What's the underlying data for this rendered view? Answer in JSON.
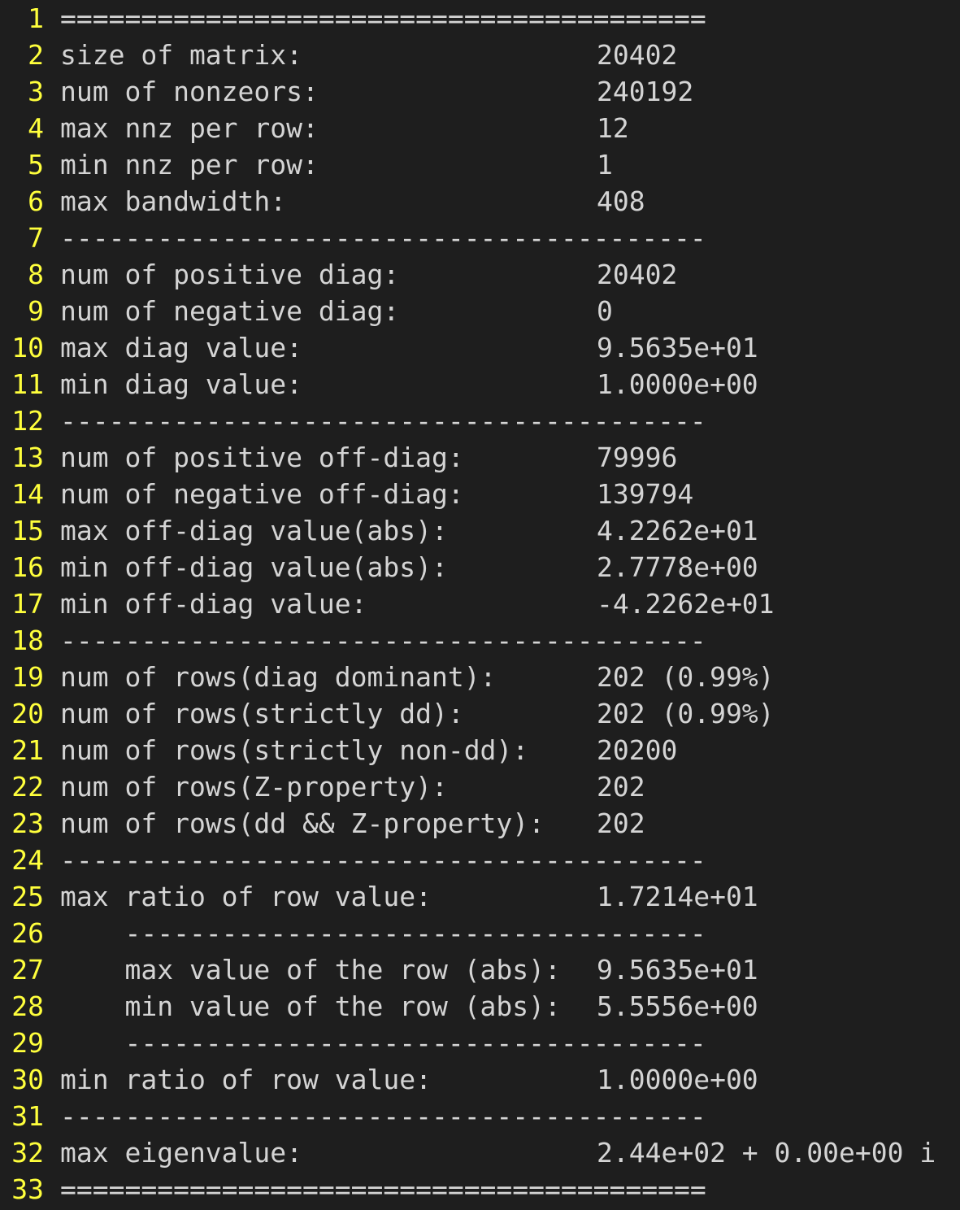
{
  "lines": [
    {
      "n": "1",
      "label": "========================================",
      "value": ""
    },
    {
      "n": "2",
      "label": "size of matrix:",
      "value": "20402"
    },
    {
      "n": "3",
      "label": "num of nonzeors:",
      "value": "240192"
    },
    {
      "n": "4",
      "label": "max nnz per row:",
      "value": "12"
    },
    {
      "n": "5",
      "label": "min nnz per row:",
      "value": "1"
    },
    {
      "n": "6",
      "label": "max bandwidth:",
      "value": "408"
    },
    {
      "n": "7",
      "label": "----------------------------------------",
      "value": ""
    },
    {
      "n": "8",
      "label": "num of positive diag:",
      "value": "20402"
    },
    {
      "n": "9",
      "label": "num of negative diag:",
      "value": "0"
    },
    {
      "n": "10",
      "label": "max diag value:",
      "value": "9.5635e+01"
    },
    {
      "n": "11",
      "label": "min diag value:",
      "value": "1.0000e+00"
    },
    {
      "n": "12",
      "label": "----------------------------------------",
      "value": ""
    },
    {
      "n": "13",
      "label": "num of positive off-diag:",
      "value": "79996"
    },
    {
      "n": "14",
      "label": "num of negative off-diag:",
      "value": "139794"
    },
    {
      "n": "15",
      "label": "max off-diag value(abs):",
      "value": "4.2262e+01"
    },
    {
      "n": "16",
      "label": "min off-diag value(abs):",
      "value": "2.7778e+00"
    },
    {
      "n": "17",
      "label": "min off-diag value:",
      "value": "-4.2262e+01"
    },
    {
      "n": "18",
      "label": "----------------------------------------",
      "value": ""
    },
    {
      "n": "19",
      "label": "num of rows(diag dominant):",
      "value": "202 (0.99%)"
    },
    {
      "n": "20",
      "label": "num of rows(strictly dd):",
      "value": "202 (0.99%)"
    },
    {
      "n": "21",
      "label": "num of rows(strictly non-dd):",
      "value": "20200"
    },
    {
      "n": "22",
      "label": "num of rows(Z-property):",
      "value": "202"
    },
    {
      "n": "23",
      "label": "num of rows(dd && Z-property):",
      "value": "202"
    },
    {
      "n": "24",
      "label": "----------------------------------------",
      "value": ""
    },
    {
      "n": "25",
      "label": "max ratio of row value:",
      "value": "1.7214e+01"
    },
    {
      "n": "26",
      "label": "    ------------------------------------",
      "value": ""
    },
    {
      "n": "27",
      "label": "    max value of the row (abs):",
      "value": "9.5635e+01"
    },
    {
      "n": "28",
      "label": "    min value of the row (abs):",
      "value": "5.5556e+00"
    },
    {
      "n": "29",
      "label": "    ------------------------------------",
      "value": ""
    },
    {
      "n": "30",
      "label": "min ratio of row value:",
      "value": "1.0000e+00"
    },
    {
      "n": "31",
      "label": "----------------------------------------",
      "value": ""
    },
    {
      "n": "32",
      "label": "max eigenvalue:",
      "value": "2.44e+02 + 0.00e+00 i"
    },
    {
      "n": "33",
      "label": "========================================",
      "value": ""
    }
  ],
  "colors": {
    "background": "#1e1e1e",
    "line_number": "#ffff3c",
    "text": "#d4d4d4"
  }
}
